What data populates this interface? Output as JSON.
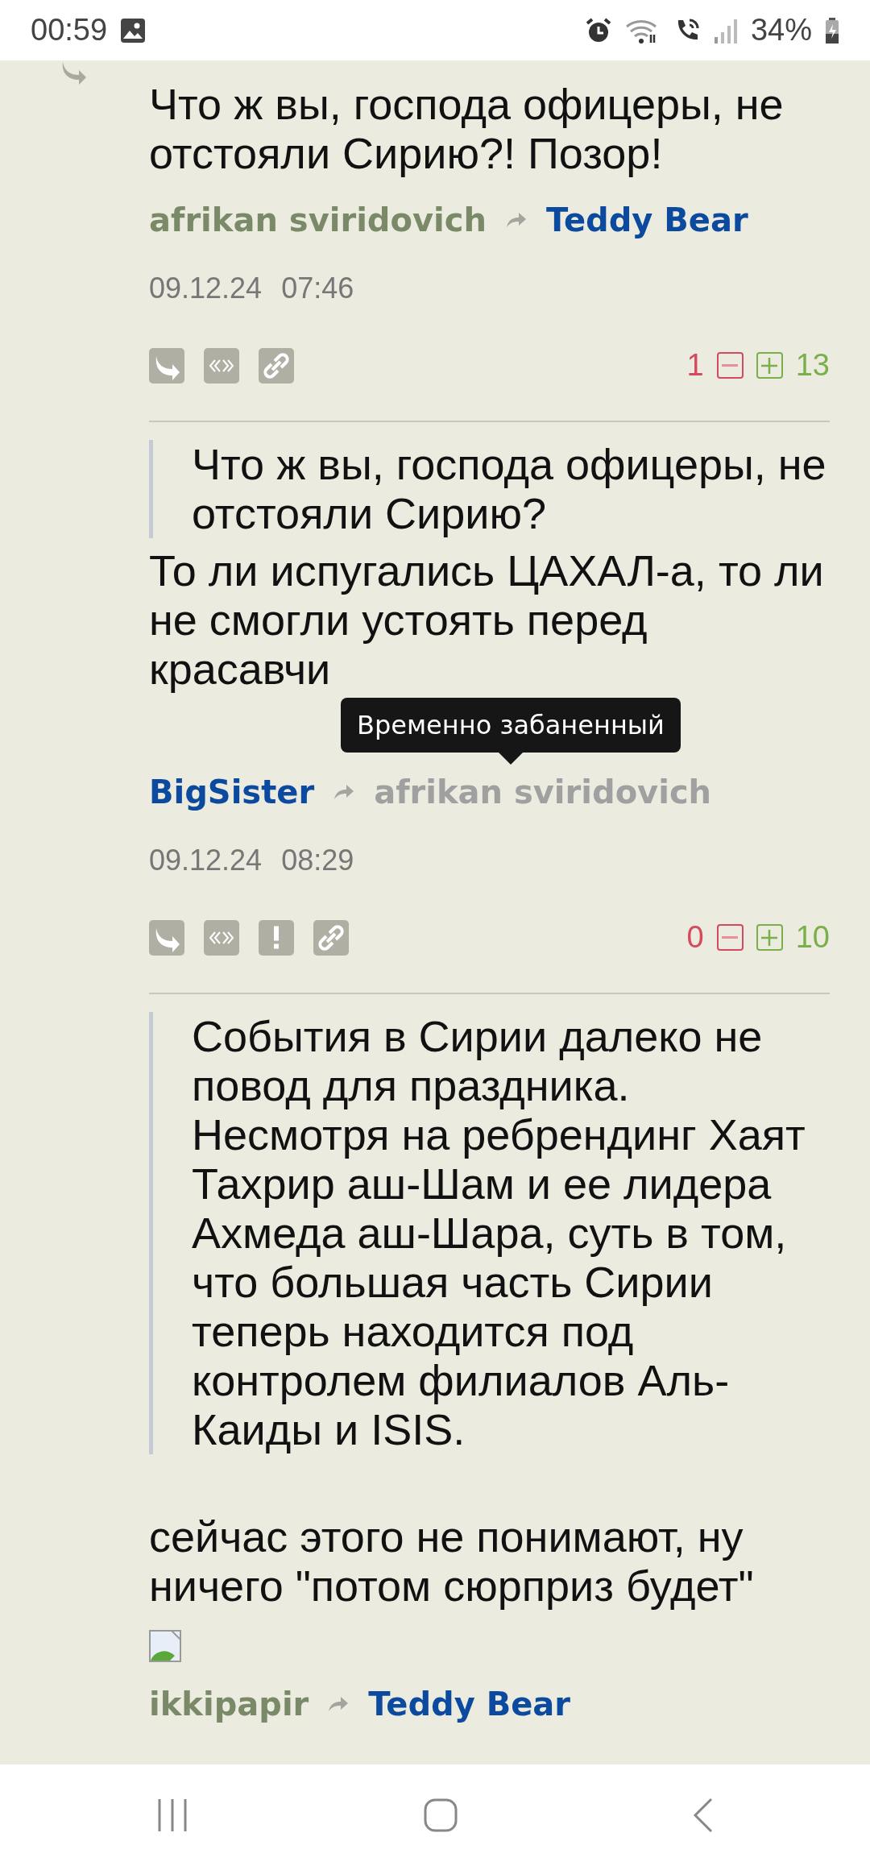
{
  "status_bar": {
    "time": "00:59",
    "battery": "34%"
  },
  "comments": [
    {
      "text": [
        "Что ж вы, господа офицеры, не отстояли Сирию?! Позор!"
      ],
      "reply_marker": true,
      "author": {
        "name": "afrikan sviridovich",
        "color": "#7a8a68"
      },
      "reply_to": {
        "name": "Teddy Bear",
        "color": "#0b4a9e"
      },
      "date": "09.12.24",
      "time": "07:46",
      "actions": [
        {
          "kind": "reply"
        },
        {
          "kind": "quote"
        },
        {
          "kind": "link"
        }
      ],
      "minus": "1",
      "plus": "13"
    },
    {
      "quote": [
        "Что ж вы, господа офицеры, не отстояли Сирию?"
      ],
      "text": [
        "То ли испугались ЦАХАЛ-а, то ли не смогли устоять перед красавчи"
      ],
      "author": {
        "name": "BigSister",
        "color": "#0b4a9e"
      },
      "reply_to": {
        "name": "afrikan sviridovich",
        "color": "#a0a0a0"
      },
      "date": "09.12.24",
      "time": "08:29",
      "actions": [
        {
          "kind": "reply"
        },
        {
          "kind": "quote"
        },
        {
          "kind": "report"
        },
        {
          "kind": "link"
        }
      ],
      "minus": "0",
      "plus": "10",
      "tooltip": "Временно забаненный"
    },
    {
      "quote": [
        "События в Сирии далеко не повод для праздника. Несмотря на ребрендинг Хаят Тахрир аш-Шам и ее лидера Ахмеда аш-Шара, суть в том, что большая часть Сирии теперь находится под контролем филиалов Аль-Каиды и ISIS."
      ],
      "text": [
        "сейчас этого не понимают, ну ничего \"потом сюрприз будет\""
      ],
      "avatar": true,
      "author": {
        "name": "ikkipapir",
        "color": "#7a8a68"
      },
      "reply_to": {
        "name": "Teddy Bear",
        "color": "#0b4a9e"
      }
    }
  ]
}
